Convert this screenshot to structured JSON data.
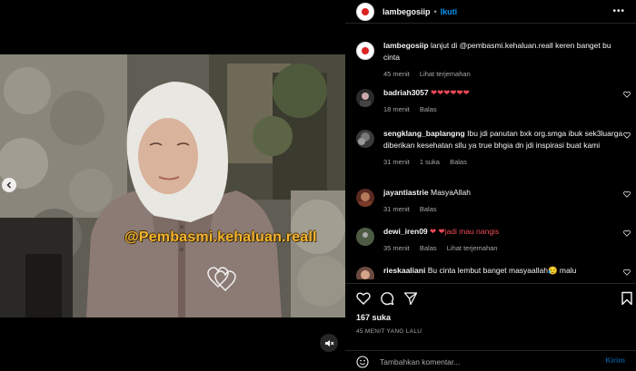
{
  "post": {
    "author": "lambegosiip",
    "separator": "•",
    "follow_label": "Ikuti",
    "more_icon": "more-horizontal-icon",
    "overlay_text": "@Pembasmi.kehaluan.reall",
    "caption": {
      "username": "lambegosiip",
      "text": "lanjut di @pembasmi.kehaluan.reall keren banget bu cinta",
      "time": "45 menit",
      "translate": "Lihat terjemahan"
    },
    "likes": "167 suka",
    "date": "45 MENIT YANG LALU"
  },
  "comments": [
    {
      "username": "badriah3057",
      "text": "❤❤❤❤❤❤",
      "time": "18 menit",
      "likes": "",
      "reply": "Balas",
      "translate": ""
    },
    {
      "username": "sengklang_baplangng",
      "text": "Ibu jdi panutan bxk org.smga ibuk sek3luarga diberikan kesehatan sllu ya true bhgia dn jdi inspirasi buat kami",
      "time": "31 menit",
      "likes": "1 suka",
      "reply": "Balas",
      "translate": ""
    },
    {
      "username": "jayantiastrie",
      "text": "MasyaAllah",
      "time": "31 menit",
      "likes": "",
      "reply": "Balas",
      "translate": ""
    },
    {
      "username": "dewi_iren09",
      "text": "❤ ❤jadi mau nangis",
      "time": "35 menit",
      "likes": "",
      "reply": "Balas",
      "translate": "Lihat terjemahan"
    },
    {
      "username": "rieskaaliani",
      "text": "Bu cinta lembut banget masyaallah😥 malu",
      "time": "",
      "likes": "",
      "reply": "",
      "translate": ""
    }
  ],
  "add_comment": {
    "placeholder": "Tambahkan komentar...",
    "post_label": "Kirim"
  },
  "colors": {
    "background": "#000000",
    "link_blue": "#0095f6",
    "secondary_text": "#a8a8a8",
    "overlay_orange": "#f7b52f",
    "heart_red": "#ed4956"
  }
}
